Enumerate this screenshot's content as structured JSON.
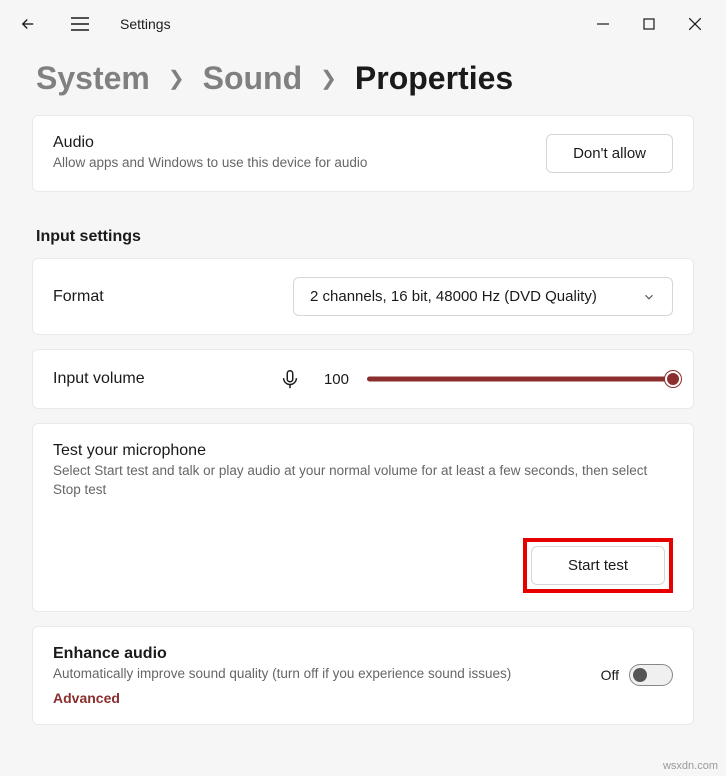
{
  "header": {
    "app_title": "Settings"
  },
  "breadcrumb": {
    "items": [
      "System",
      "Sound",
      "Properties"
    ]
  },
  "audio_card": {
    "title": "Audio",
    "subtitle": "Allow apps and Windows to use this device for audio",
    "button": "Don't allow"
  },
  "input_section": {
    "header": "Input settings",
    "format": {
      "label": "Format",
      "selected": "2 channels, 16 bit, 48000 Hz (DVD Quality)"
    },
    "volume": {
      "label": "Input volume",
      "value": "100"
    },
    "test": {
      "title": "Test your microphone",
      "subtitle": "Select Start test and talk or play audio at your normal volume for at least a few seconds, then select Stop test",
      "button": "Start test"
    },
    "enhance": {
      "title": "Enhance audio",
      "subtitle": "Automatically improve sound quality (turn off if you experience sound issues)",
      "link": "Advanced",
      "toggle_state": "Off"
    }
  },
  "watermark": "wsxdn.com"
}
